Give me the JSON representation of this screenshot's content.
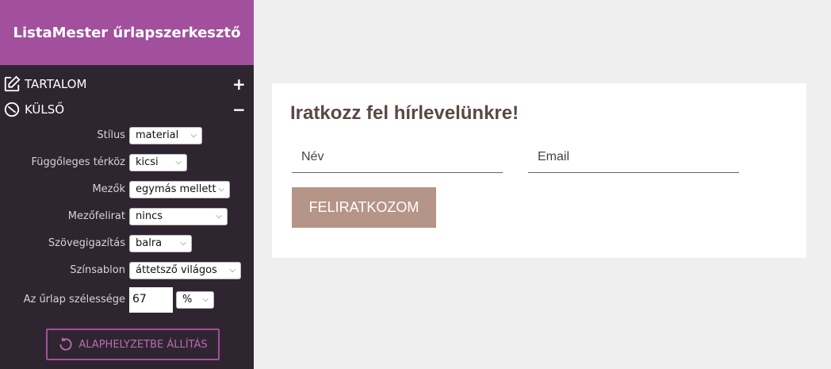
{
  "brand": {
    "title": "ListaMester űrlapszerkesztő"
  },
  "sections": {
    "content": {
      "label": "TARTALOM",
      "toggle": "+"
    },
    "appearance": {
      "label": "KÜLSŐ",
      "toggle": "−"
    }
  },
  "settings": {
    "style": {
      "label": "Stílus",
      "value": "material"
    },
    "vertical_spacing": {
      "label": "Függőleges térköz",
      "value": "kicsi"
    },
    "fields": {
      "label": "Mezők",
      "value": "egymás mellett"
    },
    "field_label": {
      "label": "Mezőfelirat",
      "value": "nincs"
    },
    "text_align": {
      "label": "Szövegigazítás",
      "value": "balra"
    },
    "color_template": {
      "label": "Színsablon",
      "value": "áttetsző világos"
    },
    "form_width": {
      "label": "Az űrlap szélessége",
      "value": "67",
      "unit": "%"
    }
  },
  "reset_button": {
    "label": "ALAPHELYZETBE ÁLLÍTÁS"
  },
  "form": {
    "title": "Iratkozz fel hírlevelünkre!",
    "name_placeholder": "Név",
    "email_placeholder": "Email",
    "submit_label": "FELIRATKOZOM"
  },
  "colors": {
    "brand": "#a24f9d",
    "sidebar": "#2f2530",
    "submit": "#b59587",
    "title": "#5a4844"
  },
  "icons": {
    "content": "edit-icon",
    "appearance": "palette-icon",
    "reset": "refresh-icon",
    "dropdown": "chevron-down-icon"
  }
}
